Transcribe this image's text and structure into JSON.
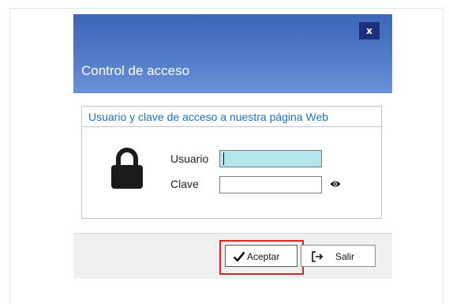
{
  "dialog": {
    "title": "Control de acceso",
    "close_label": "x"
  },
  "group": {
    "title": "Usuario y clave de acceso a nuestra página Web"
  },
  "fields": {
    "user_label": "Usuario",
    "user_value": "",
    "pass_label": "Clave",
    "pass_value": ""
  },
  "buttons": {
    "accept_label": "Aceptar",
    "exit_label": "Salir"
  },
  "icons": {
    "lock": "lock-icon",
    "eye": "eye-icon",
    "check": "checkmark-icon",
    "exit": "exit-icon"
  },
  "colors": {
    "titlebar_top": "#3c66b8",
    "titlebar_bottom": "#6a92d8",
    "close_button": "#1c2f7c",
    "group_title": "#1f73b8",
    "user_field_focus": "#b2e6ea",
    "highlight": "#d62626"
  }
}
